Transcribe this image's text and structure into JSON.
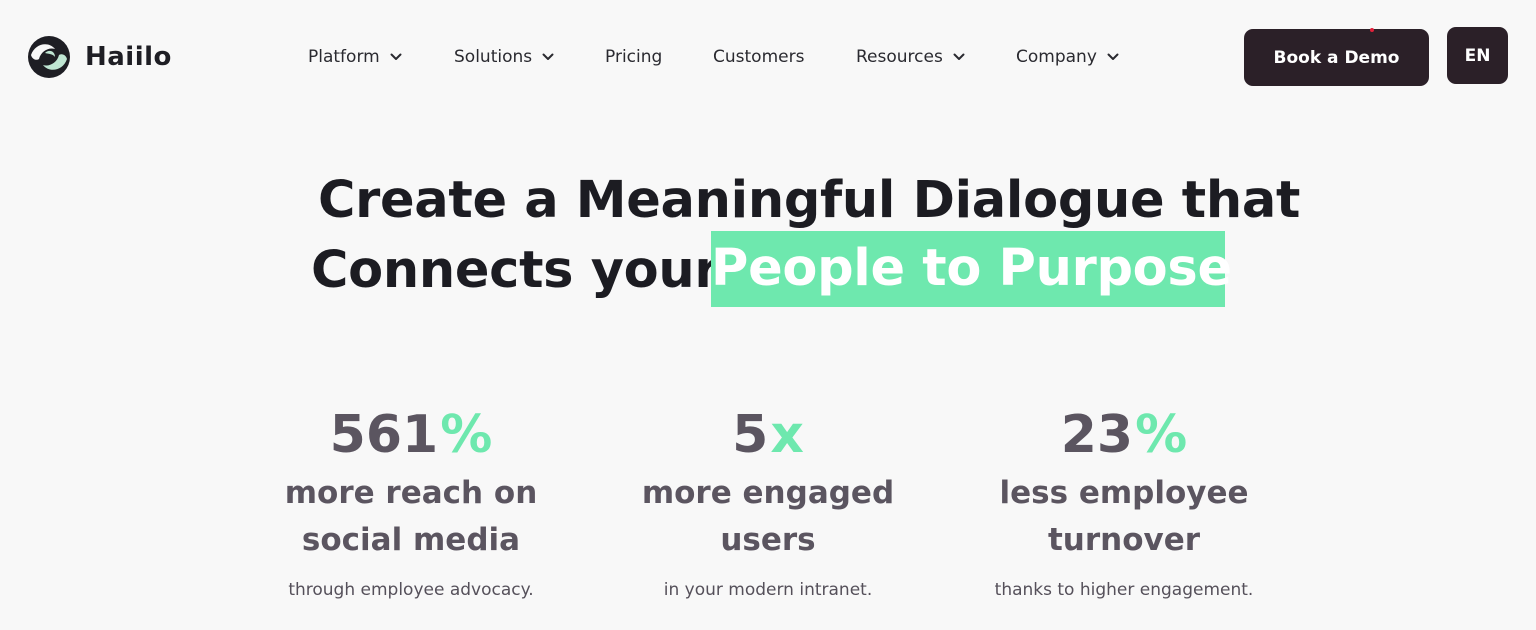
{
  "header": {
    "logo_text": "Haiilo",
    "logo_icon": "haiilo-logo-icon",
    "nav": [
      {
        "label": "Platform",
        "has_dropdown": true
      },
      {
        "label": "Solutions",
        "has_dropdown": true
      },
      {
        "label": "Pricing",
        "has_dropdown": false
      },
      {
        "label": "Customers",
        "has_dropdown": false
      },
      {
        "label": "Resources",
        "has_dropdown": true
      },
      {
        "label": "Company",
        "has_dropdown": true
      }
    ],
    "cta_label": "Book a Demo",
    "language_label": "EN"
  },
  "hero": {
    "line1": "Create a Meaningful Dialogue that",
    "line2": "Connects your",
    "highlight": "People to Purpose"
  },
  "stats": [
    {
      "number": "561",
      "suffix": "%",
      "title_line1": "more reach on",
      "title_line2": "social media",
      "subtitle": "through employee advocacy."
    },
    {
      "number": "5",
      "suffix": "x",
      "title_line1": "more engaged",
      "title_line2": "users",
      "subtitle": "in your modern intranet."
    },
    {
      "number": "23",
      "suffix": "%",
      "title_line1": "less employee",
      "title_line2": "turnover",
      "subtitle": "thanks to higher engagement."
    }
  ],
  "colors": {
    "background": "#f8f8f8",
    "accent_green": "#6ee8ae",
    "dark_button": "#2b2028",
    "text_dark": "#1c1c22",
    "stat_gray": "#5b5560"
  }
}
